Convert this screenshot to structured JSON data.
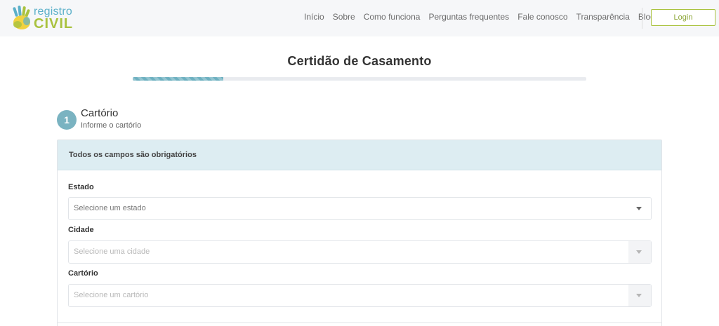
{
  "brand": {
    "logo_top": "registro",
    "logo_bottom": "CIVIL",
    "colors": {
      "blue": "#5bb0c9",
      "green": "#a9c23f",
      "yellow": "#f0d240"
    }
  },
  "nav": {
    "items": [
      "Início",
      "Sobre",
      "Como funciona",
      "Perguntas frequentes",
      "Fale conosco",
      "Transparência",
      "Blog"
    ],
    "login_label": "Login"
  },
  "page": {
    "title": "Certidão de Casamento",
    "progress_percent": 20
  },
  "step": {
    "number": "1",
    "title": "Cartório",
    "subtitle": "Informe o cartório"
  },
  "form": {
    "notice": "Todos os campos são obrigatórios",
    "fields": [
      {
        "label": "Estado",
        "placeholder": "Selecione um estado",
        "disabled": false
      },
      {
        "label": "Cidade",
        "placeholder": "Selecione uma cidade",
        "disabled": true
      },
      {
        "label": "Cartório",
        "placeholder": "Selecione um cartório",
        "disabled": true
      }
    ]
  }
}
